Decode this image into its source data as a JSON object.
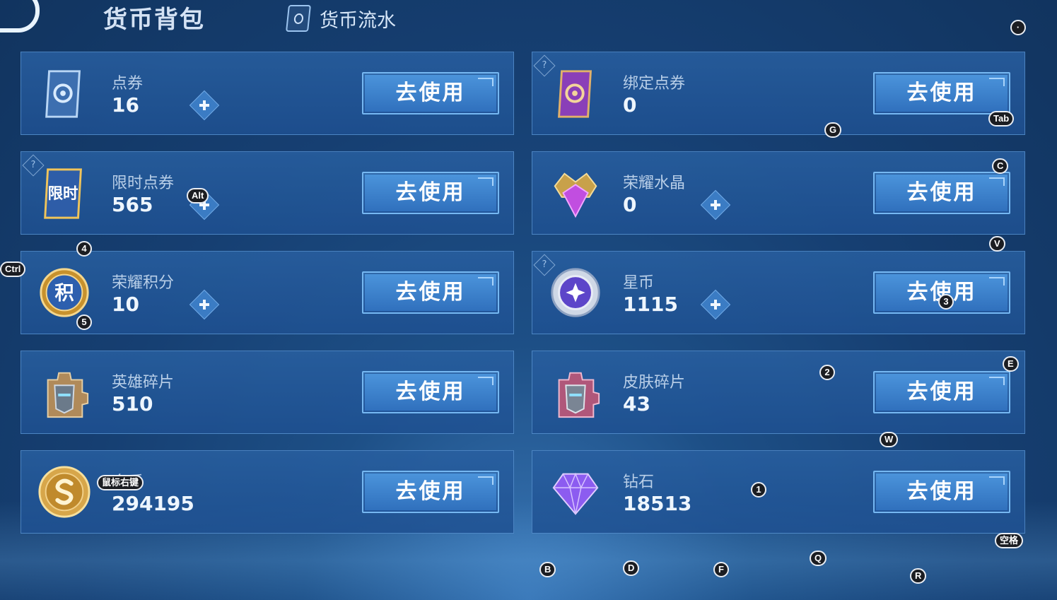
{
  "header": {
    "title": "货币背包",
    "tab_flow": "货币流水"
  },
  "button_label": "去使用",
  "help_mark": "?",
  "currencies": [
    {
      "name": "点券",
      "value": "16"
    },
    {
      "name": "绑定点券",
      "value": "0"
    },
    {
      "name": "限时点券",
      "value": "565"
    },
    {
      "name": "荣耀水晶",
      "value": "0"
    },
    {
      "name": "荣耀积分",
      "value": "10"
    },
    {
      "name": "星币",
      "value": "1115"
    },
    {
      "name": "英雄碎片",
      "value": "510"
    },
    {
      "name": "皮肤碎片",
      "value": "43"
    },
    {
      "name": "金币",
      "value": "294195"
    },
    {
      "name": "钻石",
      "value": "18513"
    }
  ],
  "icon_text": {
    "limited": "限时",
    "points": "积"
  },
  "hotkeys": {
    "dot": "·",
    "tab": "Tab",
    "g": "G",
    "alt": "Alt",
    "c": "C",
    "four": "4",
    "ctrl": "Ctrl",
    "v": "V",
    "five": "5",
    "three": "3",
    "two": "2",
    "e": "E",
    "w": "W",
    "right_click": "鼠标右键",
    "one": "1",
    "space": "空格",
    "b": "B",
    "d": "D",
    "f": "F",
    "q": "Q",
    "r": "R"
  },
  "colors": {
    "button": "#3f86d0",
    "panel": "#2a5c99"
  }
}
